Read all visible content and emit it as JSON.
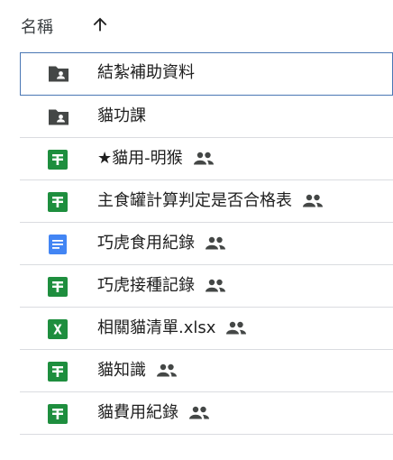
{
  "header": {
    "column_label": "名稱",
    "sort_icon": "arrow-upward-icon"
  },
  "colors": {
    "folder": "#444746",
    "sheets": "#1e8e3e",
    "docs": "#4285f4",
    "excel": "#1e8e3e",
    "selection_border": "#4a77b4",
    "divider": "#dadce0"
  },
  "files": [
    {
      "name": "結紮補助資料",
      "type": "shared-folder",
      "icon": "shared-folder-icon",
      "shared": false,
      "selected": true
    },
    {
      "name": "貓功課",
      "type": "shared-folder",
      "icon": "shared-folder-icon",
      "shared": false,
      "selected": false
    },
    {
      "name": "★貓用-明猴",
      "type": "sheets",
      "icon": "google-sheets-icon",
      "shared": true,
      "selected": false
    },
    {
      "name": "主食罐計算判定是否合格表",
      "type": "sheets",
      "icon": "google-sheets-icon",
      "shared": true,
      "selected": false
    },
    {
      "name": "巧虎食用紀錄",
      "type": "docs",
      "icon": "google-docs-icon",
      "shared": true,
      "selected": false
    },
    {
      "name": "巧虎接種記錄",
      "type": "sheets",
      "icon": "google-sheets-icon",
      "shared": true,
      "selected": false
    },
    {
      "name": "相關貓清單.xlsx",
      "type": "excel",
      "icon": "excel-file-icon",
      "shared": true,
      "selected": false
    },
    {
      "name": "貓知識",
      "type": "sheets",
      "icon": "google-sheets-icon",
      "shared": true,
      "selected": false
    },
    {
      "name": "貓費用紀錄",
      "type": "sheets",
      "icon": "google-sheets-icon",
      "shared": true,
      "selected": false
    }
  ]
}
